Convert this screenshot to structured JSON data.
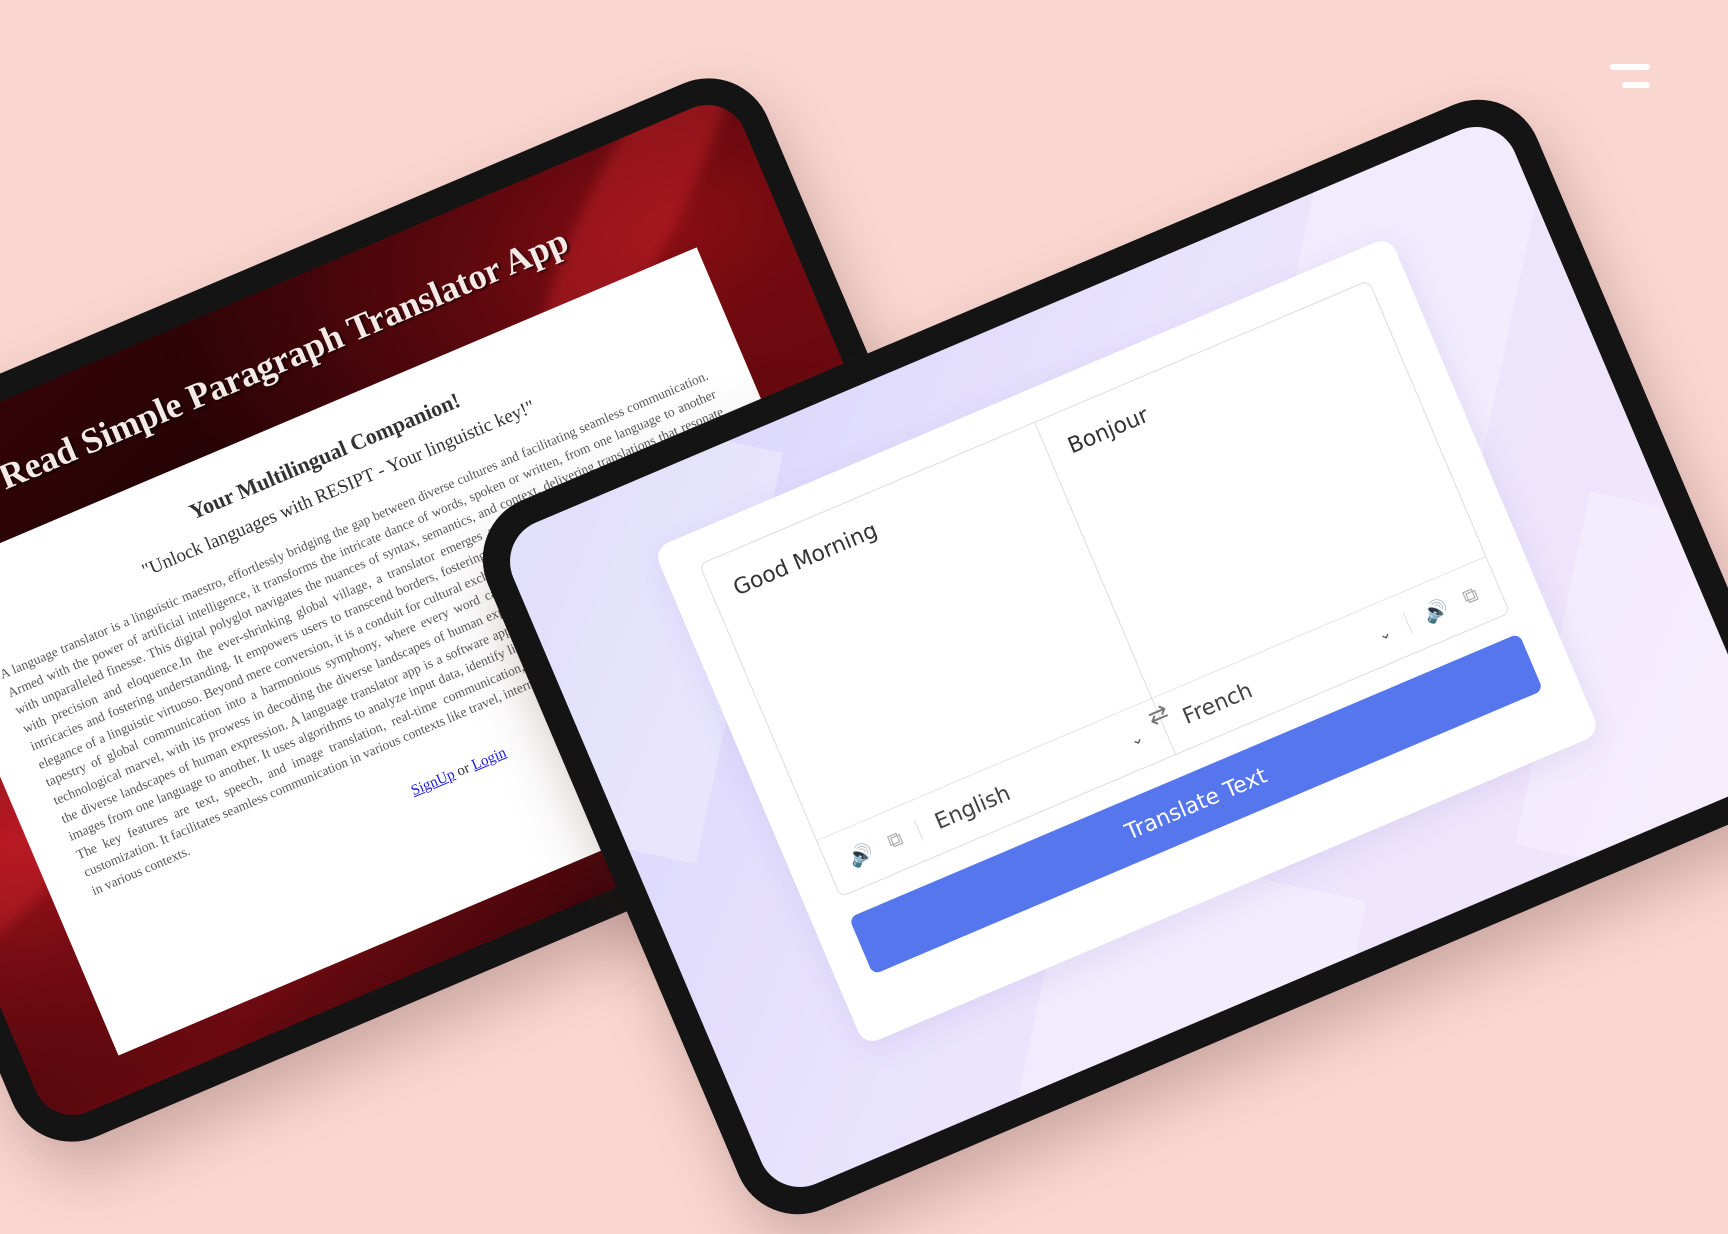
{
  "back_app": {
    "title": "Read Simple Paragraph Translator App",
    "heading": "Your Multilingual Companion!",
    "tagline": "\"Unlock languages with RESIPT - Your linguistic key!\"",
    "paragraph": "A language translator is a linguistic maestro, effortlessly bridging the gap between diverse cultures and facilitating seamless communication. Armed with the power of artificial intelligence, it transforms the intricate dance of words, spoken or written, from one language to another with unparalleled finesse. This digital polyglot navigates the nuances of syntax, semantics, and context, delivering translations that resonate with precision and eloquence.In the ever-shrinking global village, a translator emerges as the silent ambassador, unraveling linguistic intricacies and fostering understanding. It empowers users to transcend borders, fostering connections and breaking down barriers with the elegance of a linguistic virtuoso. Beyond mere conversion, it is a conduit for cultural exchange, a guardian of linguistic diversity, weaving the tapestry of global communication into a harmonious symphony, where every word carries the resonance of shared understanding. This technological marvel, with its prowess in decoding the diverse landscapes of human expression, is a linguistic companion, a guide through the diverse landscapes of human expression. A language translator app is a software application that automatically translate text, speech, or images from one language to another. It uses algorithms to analyze input data, identify linguistic patterns, and generate accurate translations. The key features are text, speech, and image translation, real-time communication, offline functionality, user-friendly interface, and customization. It facilitates seamless communication in various contexts like travel, international business, and breaks down language barriers in various contexts.",
    "signup_link": "SignUp",
    "or_text": "or",
    "login_link": "Login"
  },
  "front_app": {
    "source_text": "Good Morning",
    "target_text": "Bonjour",
    "source_language": "English",
    "target_language": "French",
    "translate_button": "Translate Text",
    "icons": {
      "speaker": "speaker-icon",
      "copy": "copy-icon",
      "swap": "swap-icon",
      "chevron": "chevron-down-icon",
      "menu": "menu-icon"
    }
  },
  "colors": {
    "background": "#f9d6cf",
    "accent": "#5576ec",
    "back_screen": "#3a0508"
  }
}
